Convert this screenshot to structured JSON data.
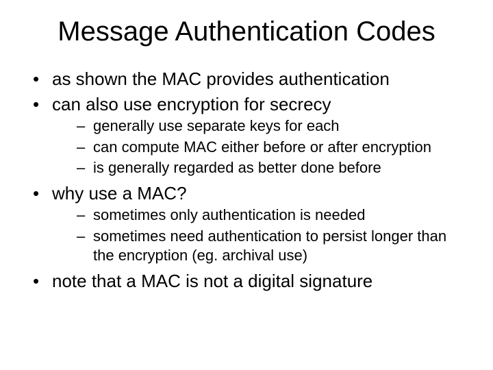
{
  "title": "Message Authentication Codes",
  "bullets": [
    {
      "text": "as shown the MAC provides authentication",
      "sub": []
    },
    {
      "text": "can also use encryption for secrecy",
      "sub": [
        "generally use separate keys for each",
        "can compute MAC either before or after encryption",
        "is generally regarded as better done before"
      ]
    },
    {
      "text": "why use a MAC?",
      "sub": [
        "sometimes only authentication is needed",
        "sometimes need authentication to persist longer than the encryption (eg. archival use)"
      ]
    },
    {
      "text": "note that a MAC is not a digital signature",
      "sub": []
    }
  ]
}
